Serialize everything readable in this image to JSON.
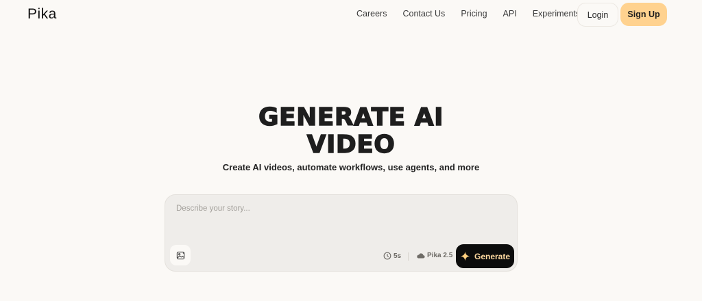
{
  "header": {
    "logo": "Pika",
    "nav": {
      "careers": "Careers",
      "contact": "Contact Us",
      "pricing": "Pricing",
      "api": "API",
      "experiments": "Experiments"
    },
    "login": "Login",
    "signup": "Sign Up"
  },
  "hero": {
    "title_line1": "GENERATE AI",
    "title_line2": "VIDEO",
    "subtitle": "Create AI videos, automate workflows, use agents, and more"
  },
  "prompt": {
    "placeholder": "Describe your story...",
    "value": "",
    "duration": "5s",
    "model": "Pika 2.5",
    "generate_label": "Generate"
  },
  "icons": {
    "image_upload": "image-icon",
    "duration": "clock-icon",
    "model": "cloud-icon",
    "generate": "sparkle-icon"
  },
  "colors": {
    "background": "#fbf9f6",
    "accent": "#ffd28f",
    "generate_bg": "#0c0c0c",
    "generate_text": "#ffd9a0",
    "prompt_bg": "#efedea"
  }
}
